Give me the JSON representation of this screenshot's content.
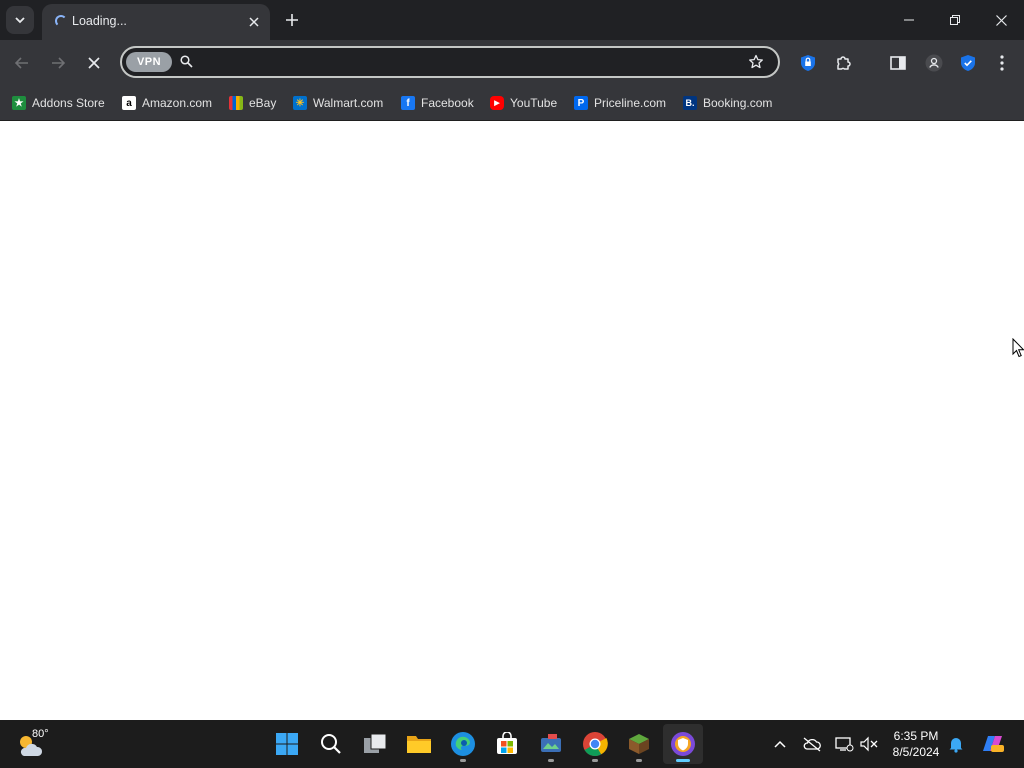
{
  "browser": {
    "tab": {
      "title": "Loading..."
    },
    "omnibox": {
      "vpn_label": "VPN",
      "value": "",
      "placeholder": ""
    },
    "bookmarks": [
      {
        "label": "Addons Store",
        "icon": "addons-store-icon",
        "color": "#1e8e3e"
      },
      {
        "label": "Amazon.com",
        "icon": "amazon-icon",
        "color": "#ffffff"
      },
      {
        "label": "eBay",
        "icon": "ebay-icon",
        "color": "#e53238"
      },
      {
        "label": "Walmart.com",
        "icon": "walmart-icon",
        "color": "#0071ce"
      },
      {
        "label": "Facebook",
        "icon": "facebook-icon",
        "color": "#1877f2"
      },
      {
        "label": "YouTube",
        "icon": "youtube-icon",
        "color": "#ff0000"
      },
      {
        "label": "Priceline.com",
        "icon": "priceline-icon",
        "color": "#0068ef"
      },
      {
        "label": "Booking.com",
        "icon": "booking-icon",
        "color": "#003580"
      }
    ]
  },
  "taskbar": {
    "weather": {
      "temp": "80°"
    },
    "clock": {
      "time": "6:35 PM",
      "date": "8/5/2024"
    }
  },
  "colors": {
    "chrome_dark": "#202124",
    "chrome_toolbar": "#35363a",
    "taskbar": "#1c1c1c",
    "accent": "#8ab4f8"
  }
}
